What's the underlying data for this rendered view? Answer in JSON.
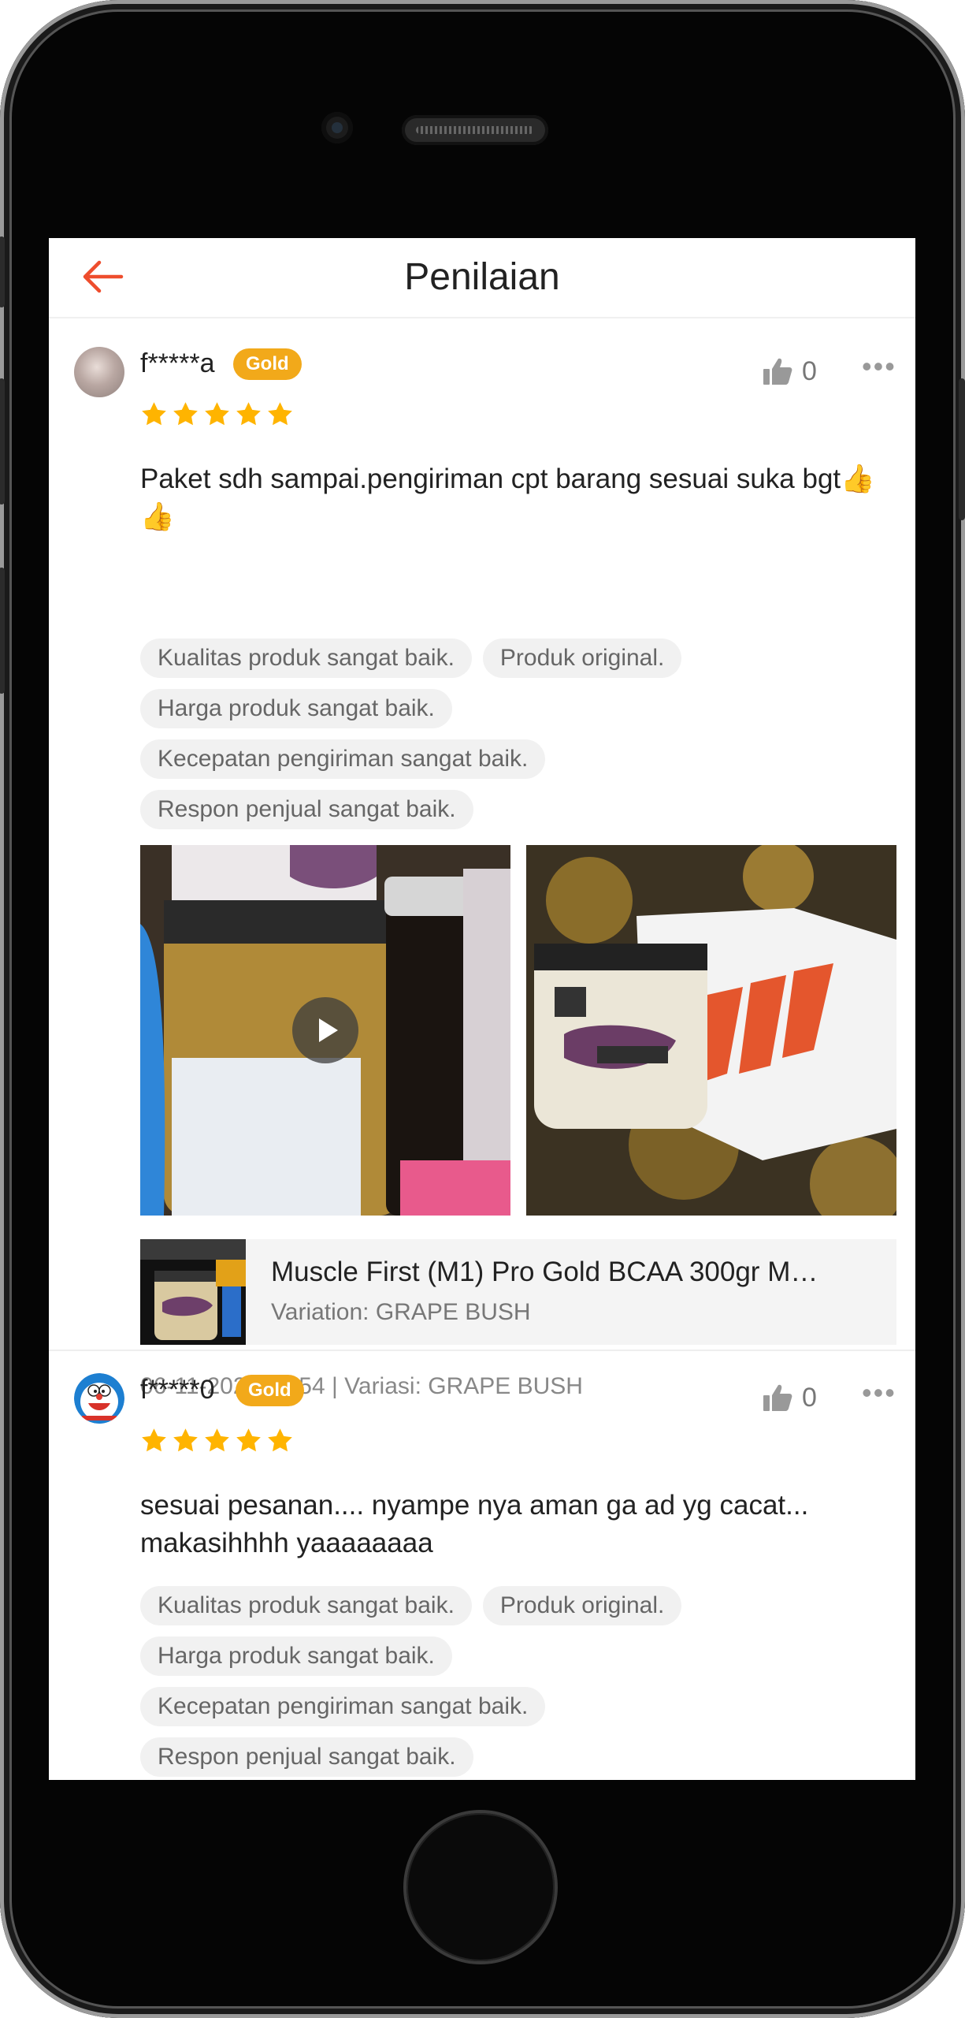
{
  "header": {
    "title": "Penilaian"
  },
  "reviews": [
    {
      "username": "f*****a",
      "badge": "Gold",
      "likes": "0",
      "rating": 5,
      "text": "Paket sdh sampai.pengiriman cpt barang sesuai suka bgt👍👍",
      "tags": [
        "Kualitas produk sangat baik.",
        "Produk original.",
        "Harga produk sangat baik.",
        "Kecepatan pengiriman sangat baik.",
        "Respon penjual sangat baik."
      ],
      "media": [
        "video",
        "photo"
      ],
      "product": {
        "name": "Muscle First (M1) Pro Gold BCAA 300gr M…",
        "variation": "Variation: GRAPE BUSH"
      },
      "meta": "06-11-2020 17:54 | Variasi: GRAPE BUSH"
    },
    {
      "username": "f*****0",
      "badge": "Gold",
      "likes": "0",
      "rating": 5,
      "text": "sesuai pesanan.... nyampe nya aman ga ad yg cacat... makasihhhh yaaaaaaaa",
      "tags": [
        "Kualitas produk sangat baik.",
        "Produk original.",
        "Harga produk sangat baik.",
        "Kecepatan pengiriman sangat baik.",
        "Respon penjual sangat baik."
      ]
    }
  ],
  "colors": {
    "accent": "#ee4d2d",
    "star": "#ffb400",
    "badge": "#f2a91a"
  },
  "icons": {
    "back": "arrow-left-icon",
    "like": "thumbs-up-icon",
    "more": "more-dots-icon",
    "play": "play-icon",
    "star": "star-icon"
  }
}
